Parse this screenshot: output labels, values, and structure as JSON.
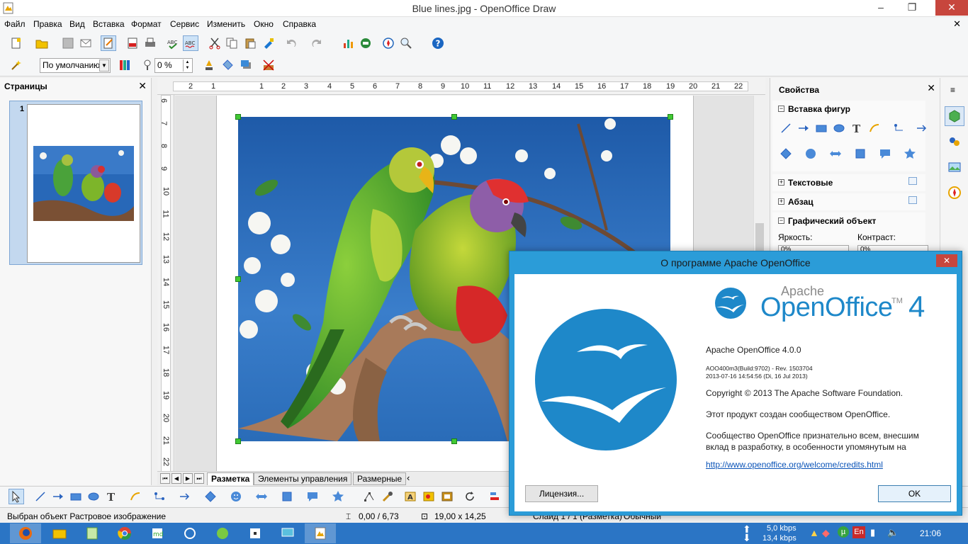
{
  "window": {
    "title": "Blue lines.jpg - OpenOffice Draw",
    "minimize_glyph": "‒",
    "restore_glyph": "❐",
    "close_glyph": "✕"
  },
  "menu": {
    "items": [
      "Файл",
      "Правка",
      "Вид",
      "Вставка",
      "Формат",
      "Сервис",
      "Изменить",
      "Окно",
      "Справка"
    ],
    "doc_close": "✕"
  },
  "toolbar2": {
    "style_combo": "По умолчанию",
    "transparency": "0 %"
  },
  "pages_pane": {
    "title": "Страницы",
    "close": "✕",
    "page_number": "1"
  },
  "ruler": {
    "h": [
      "2",
      "1",
      "1",
      "2",
      "3",
      "4",
      "5",
      "6",
      "7",
      "8",
      "9",
      "10",
      "11",
      "12",
      "13",
      "14",
      "15",
      "16",
      "17",
      "18",
      "19",
      "20",
      "21",
      "22"
    ],
    "v": [
      "6",
      "7",
      "8",
      "9",
      "10",
      "11",
      "12",
      "13",
      "14",
      "15",
      "16",
      "17",
      "18",
      "19",
      "20",
      "21",
      "22"
    ]
  },
  "layer_tabs": [
    "Разметка",
    "Элементы управления",
    "Размерные"
  ],
  "status": {
    "selection": "Выбран объект Растровое изображение",
    "position": "0,00 / 6,73",
    "size": "19,00 x 14,25",
    "slide": "Слайд 1 / 1 (Разметка)",
    "layout": "Обычный"
  },
  "sidebar": {
    "title": "Свойства",
    "close": "✕",
    "sections": {
      "shapes": "Вставка фигур",
      "text": "Текстовые",
      "paragraph": "Абзац",
      "graphic": "Графический объект"
    },
    "brightness_label": "Яркость:",
    "contrast_label": "Контраст:",
    "brightness_value": "0%",
    "contrast_value": "0%"
  },
  "about": {
    "title": "О программе Apache OpenOffice",
    "close": "✕",
    "logo_apache": "Apache",
    "logo_name": "OpenOffice",
    "logo_tm": "TM",
    "logo_version": "4",
    "version": "Apache OpenOffice 4.0.0",
    "build1": "AOO400m3(Build:9702)  -  Rev. 1503704",
    "build2": "2013-07-16 14:54:56 (Di, 16 Jul 2013)",
    "copyright": "Copyright © 2013 The Apache Software Foundation.",
    "community": "Этот продукт создан сообществом OpenOffice.",
    "thanks1": "Сообщество OpenOffice признательно всем, внесшим",
    "thanks2": "вклад в разработку, в особенности упомянутым на",
    "link": "http://www.openoffice.org/welcome/credits.html",
    "license_button": "Лицензия...",
    "ok_button": "OK"
  },
  "taskbar": {
    "net_up": "5,0 kbps",
    "net_down": "13,4 kbps",
    "lang": "En",
    "clock": "21:06"
  },
  "colors": {
    "accent": "#2b9cd8",
    "taskbar": "#2b75c5",
    "oo_blue": "#1e88c9",
    "handle": "#41c934"
  }
}
